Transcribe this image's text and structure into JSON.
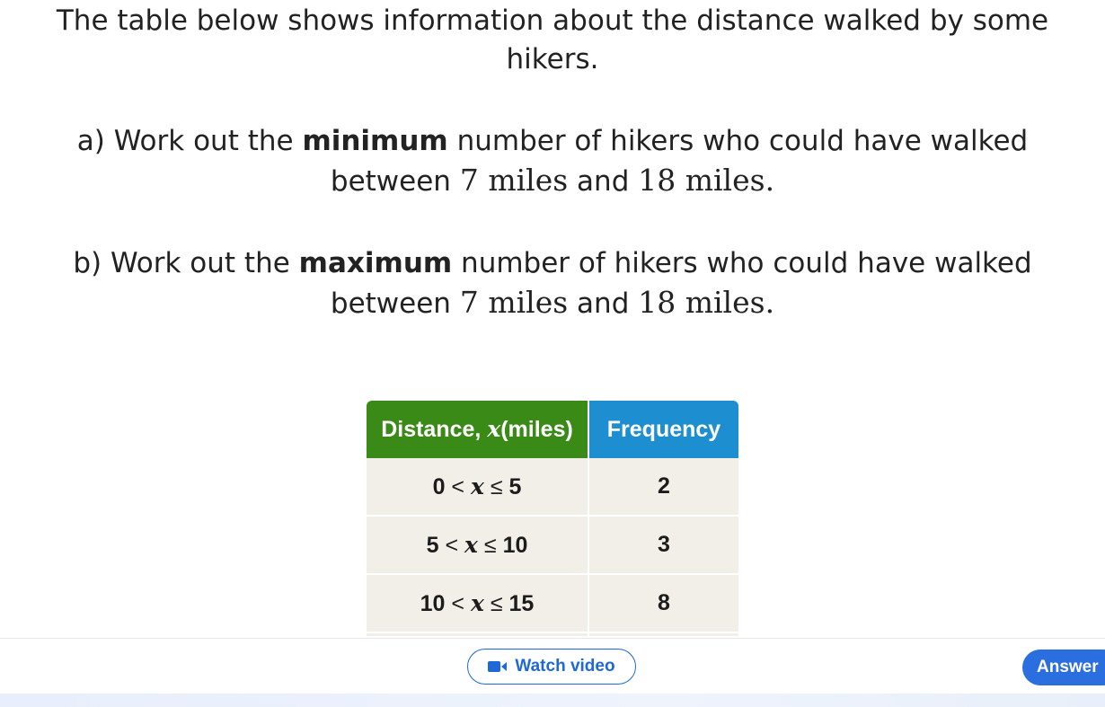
{
  "question": {
    "intro": "The table below shows information about the distance walked by some hikers.",
    "part_a": {
      "prefix": "a) Work out the",
      "emphasis": "minimum",
      "suffix": "number of hikers who could have walked between",
      "low": "7 miles",
      "and": "and",
      "high": "18 miles."
    },
    "part_b": {
      "prefix": "b) Work out the",
      "emphasis": "maximum",
      "suffix": "number of hikers who could have walked between",
      "low": "7 miles",
      "and": "and",
      "high": "18 miles."
    }
  },
  "table": {
    "header_distance_prefix": "Distance,",
    "header_distance_var": "x",
    "header_distance_unit": "(miles)",
    "header_frequency": "Frequency",
    "rows": [
      {
        "low": "0",
        "op1": "<",
        "var": "x",
        "op2": "≤",
        "high": "5",
        "frequency": "2"
      },
      {
        "low": "5",
        "op1": "<",
        "var": "x",
        "op2": "≤",
        "high": "10",
        "frequency": "3"
      },
      {
        "low": "10",
        "op1": "<",
        "var": "x",
        "op2": "≤",
        "high": "15",
        "frequency": "8"
      }
    ],
    "header_colors": {
      "distance": "#3a8a18",
      "frequency": "#1d8ed0"
    }
  },
  "toolbar": {
    "watch_video_label": "Watch video",
    "watch_video_icon": "video-camera-icon",
    "answer_label": "Answer",
    "accent": "#2a6ee0"
  }
}
